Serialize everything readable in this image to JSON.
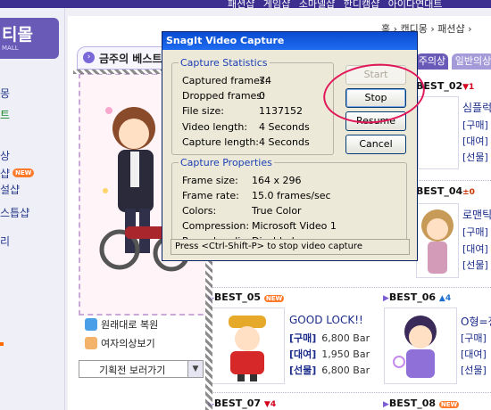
{
  "site": {
    "top_nav": [
      "패션샵",
      "게임샵",
      "소마넬샵",
      "한디캠샵",
      "아이다연대트"
    ],
    "brand_title": "티몰",
    "brand_sub": "MALL",
    "left_nav": [
      {
        "label": "몽",
        "color": "#263a8a"
      },
      {
        "label": "트",
        "color": "#118822"
      },
      {
        "label": "상",
        "color": "#263a8a"
      },
      {
        "label": "샵",
        "color": "#263a8a",
        "badge": "NEW"
      },
      {
        "label": "설샵",
        "color": "#263a8a"
      },
      {
        "label": "스틉샵",
        "color": "#263a8a"
      },
      {
        "label": "리",
        "color": "#263a8a"
      }
    ],
    "breadcrumb": "홈 › 캔디몽 › 패션샵 ›",
    "section_title": "금주의 베스트",
    "tabs": [
      "주의상",
      "일반의상"
    ],
    "links": [
      "원래대로 복원",
      "여자의상보기"
    ],
    "select_value": "기획전 보러가기",
    "best_items": [
      {
        "label": "BEST_02",
        "rank": "▼1",
        "rank_kind": "down",
        "name": "심플럭",
        "lines": [
          "[구매]",
          "[대여]",
          "[선물]"
        ]
      },
      {
        "label": "BEST_04",
        "rank": "±0",
        "rank_kind": "eq",
        "name": "로맨틱",
        "lines": [
          "[구매]",
          "[대여]",
          "[선물]"
        ]
      },
      {
        "label": "BEST_05",
        "badge": "NEW",
        "name": "GOOD LOCK!!",
        "lines": [
          {
            "k": "[구매]",
            "v": "6,800 Bar"
          },
          {
            "k": "[대여]",
            "v": "1,950 Bar"
          },
          {
            "k": "[선물]",
            "v": "6,800 Bar"
          }
        ]
      },
      {
        "label": "BEST_06",
        "rank": "▲4",
        "rank_kind": "up",
        "name": "O형=정",
        "lines": [
          "[구매]",
          "[대여]",
          "[선물]"
        ]
      },
      {
        "label": "BEST_07",
        "rank": "▼4",
        "rank_kind": "down"
      },
      {
        "label": "BEST_08",
        "badge": "NEW"
      }
    ]
  },
  "dialog": {
    "title": "SnagIt Video Capture",
    "stats_title": "Capture Statistics",
    "stats": [
      {
        "key": "Captured frames:",
        "value": "74"
      },
      {
        "key": "Dropped frames:",
        "value": "0"
      },
      {
        "key": "File size:",
        "value": "1137152"
      },
      {
        "key": "Video length:",
        "value": "4 Seconds"
      },
      {
        "key": "Capture length:",
        "value": "4 Seconds"
      }
    ],
    "props_title": "Capture Properties",
    "props": [
      {
        "key": "Frame size:",
        "value": "164 x 296"
      },
      {
        "key": "Frame rate:",
        "value": "15.0 frames/sec"
      },
      {
        "key": "Colors:",
        "value": "True Color"
      },
      {
        "key": "Compression:",
        "value": "Microsoft Video 1"
      },
      {
        "key": "Record audio:",
        "value": "Disabled"
      }
    ],
    "buttons": {
      "start": "Start",
      "stop": "Stop",
      "resume": "Resume",
      "cancel": "Cancel"
    },
    "status": "Press <Ctrl-Shift-P> to stop video capture"
  },
  "colors": {
    "title_bar": "#0a4bd0",
    "highlight_ellipse": "#e0185a",
    "brand": "#6a5ab8"
  }
}
